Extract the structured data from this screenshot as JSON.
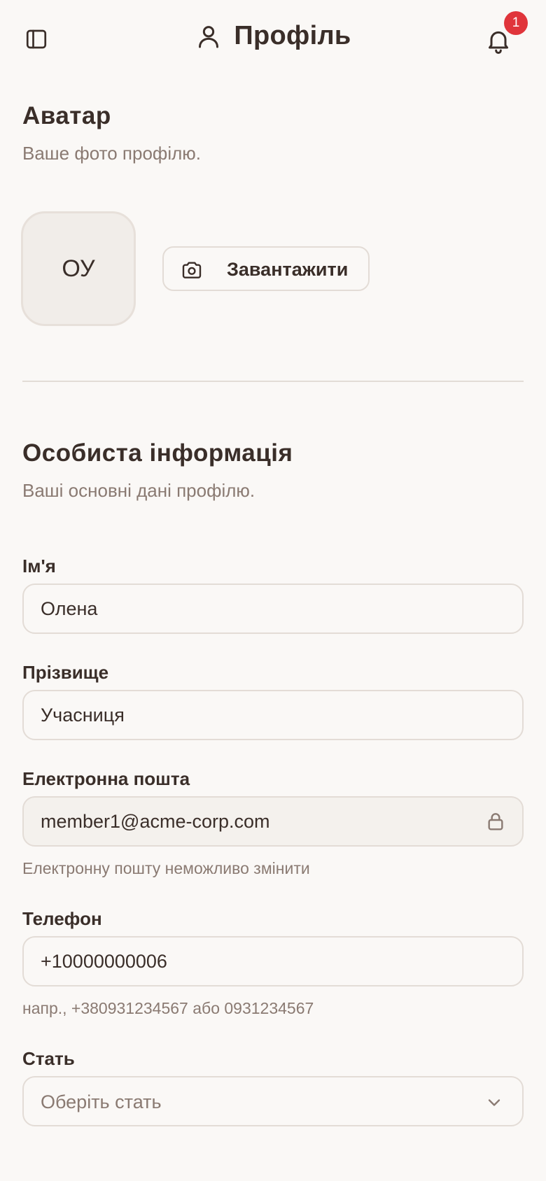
{
  "header": {
    "title": "Профіль",
    "notification_count": "1",
    "icons": {
      "sidebar": "sidebar-toggle-icon",
      "profile": "user-icon",
      "bell": "bell-icon"
    }
  },
  "avatar_section": {
    "title": "Аватар",
    "subtitle": "Ваше фото профілю.",
    "initials": "ОУ",
    "upload_label": "Завантажити"
  },
  "personal_section": {
    "title": "Особиста інформація",
    "subtitle": "Ваші основні дані профілю."
  },
  "form": {
    "first_name": {
      "label": "Ім'я",
      "value": "Олена"
    },
    "last_name": {
      "label": "Прізвище",
      "value": "Учасниця"
    },
    "email": {
      "label": "Електронна пошта",
      "value": "member1@acme-corp.com",
      "hint": "Електронну пошту неможливо змінити"
    },
    "phone": {
      "label": "Телефон",
      "value": "+10000000006",
      "hint": "напр., +380931234567 або 0931234567"
    },
    "gender": {
      "label": "Стать",
      "placeholder": "Оберіть стать"
    }
  },
  "colors": {
    "background": "#faf8f6",
    "text": "#3a2e29",
    "muted": "#8a7a72",
    "badge": "#e0353b",
    "border": "#e3dcd6"
  }
}
